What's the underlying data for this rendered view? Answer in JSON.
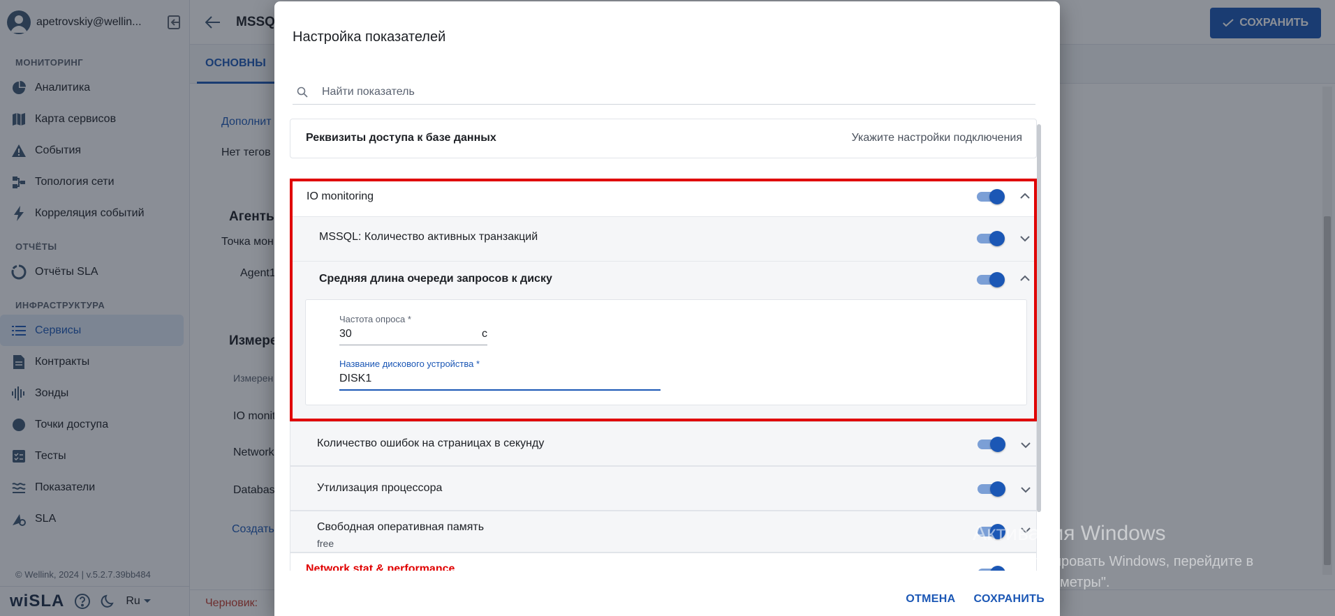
{
  "sidebar": {
    "user_email": "apetrovskiy@wellin...",
    "sections": [
      {
        "title": "МОНИТОРИНГ",
        "items": [
          "Аналитика",
          "Карта сервисов",
          "События",
          "Топология сети",
          "Корреляция событий"
        ]
      },
      {
        "title": "ОТЧЁТЫ",
        "items": [
          "Отчёты SLA"
        ]
      },
      {
        "title": "ИНФРАСТРУКТУРА",
        "items": [
          "Сервисы",
          "Контракты",
          "Зонды",
          "Точки доступа",
          "Тесты",
          "Показатели",
          "SLA"
        ]
      }
    ],
    "active_item": "Сервисы",
    "copyright": "© Wellink, 2024 | v.5.2.7.39bb484",
    "logo": "wiSLA",
    "language": "Ru"
  },
  "main": {
    "title": "MSSQL",
    "save_label": "СОХРАНИТЬ",
    "tab_main": "ОСНОВНЫ",
    "bg": {
      "additional": "Дополнит",
      "no_tags": "Нет тегов",
      "agents": "Агенты",
      "point": "Точка мон",
      "agent1": "Agent1",
      "measure": "Измерен",
      "measure_col": "Измерен",
      "io": "IO monit",
      "network": "Network",
      "database": "Databas",
      "create": "Создать"
    },
    "draft": "Черновик:"
  },
  "dialog": {
    "title": "Настройка показателей",
    "search_placeholder": "Найти показатель",
    "credentials": {
      "label": "Реквизиты доступа к базе данных",
      "hint": "Укажите настройки подключения"
    },
    "io_group": {
      "title": "IO monitoring",
      "sub1": "MSSQL: Количество активных транзакций",
      "sub2": "Средняя длина очереди запросов к диску",
      "poll_label": "Частота опроса *",
      "poll_value": "30",
      "poll_unit": "с",
      "disk_label": "Название дискового устройства *",
      "disk_value": "DISK1"
    },
    "page_errors": "Количество ошибок на страницах в секунду",
    "cpu_util": "Утилизация процессора",
    "free_mem": {
      "title": "Свободная оперативная память",
      "subtitle": "free"
    },
    "network_group": "Network stat & performance",
    "cancel": "ОТМЕНА",
    "save": "СОХРАНИТЬ"
  },
  "watermark": {
    "title": "Активация Windows",
    "text": "Чтобы активировать Windows, перейдите в раздел \"Параметры\"."
  },
  "colors": {
    "primary": "#1b57b5",
    "highlight": "#e00000"
  }
}
